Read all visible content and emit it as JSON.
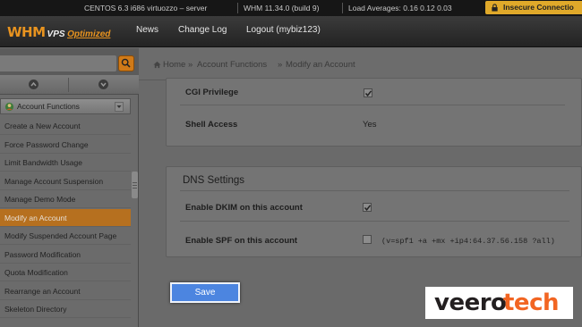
{
  "statusbar": {
    "os": "CENTOS 6.3 i686 virtuozzo – server",
    "version": "WHM 11.34.0 (build 9)",
    "load": "Load Averages: 0.16 0.12 0.03",
    "insecure": "Insecure Connectio"
  },
  "header": {
    "logo_whm": "WHM",
    "logo_vps": "VPS",
    "logo_optimized": "Optimized",
    "nav": [
      "News",
      "Change Log",
      "Logout (mybiz123)"
    ]
  },
  "breadcrumb": {
    "home": "Home",
    "separator": "»",
    "items": [
      "Account Functions",
      "Modify an Account"
    ]
  },
  "sidebar": {
    "category": "Account Functions",
    "items": [
      "Create a New Account",
      "Force Password Change",
      "Limit Bandwidth Usage",
      "Manage Account Suspension",
      "Manage Demo Mode",
      "Modify an Account",
      "Modify Suspended Account Page",
      "Password Modification",
      "Quota Modification",
      "Rearrange an Account",
      "Skeleton Directory"
    ],
    "active_index": 5
  },
  "privileges": {
    "cgi_label": "CGI Privilege",
    "cgi_checked": true,
    "shell_label": "Shell Access",
    "shell_value": "Yes"
  },
  "dns": {
    "title": "DNS Settings",
    "dkim_label": "Enable DKIM on this account",
    "dkim_checked": true,
    "spf_label": "Enable SPF on this account",
    "spf_checked": false,
    "spf_record": "(v=spf1 +a +mx +ip4:64.37.56.158 ?all)"
  },
  "save_label": "Save",
  "watermark": {
    "part1": "veero",
    "part2": "tech"
  },
  "colors": {
    "accent": "#e8931f",
    "active_menu": "#b6701f",
    "save_button": "#4c85e0",
    "watermark_dark": "#231f20",
    "watermark_accent": "#f26522"
  }
}
